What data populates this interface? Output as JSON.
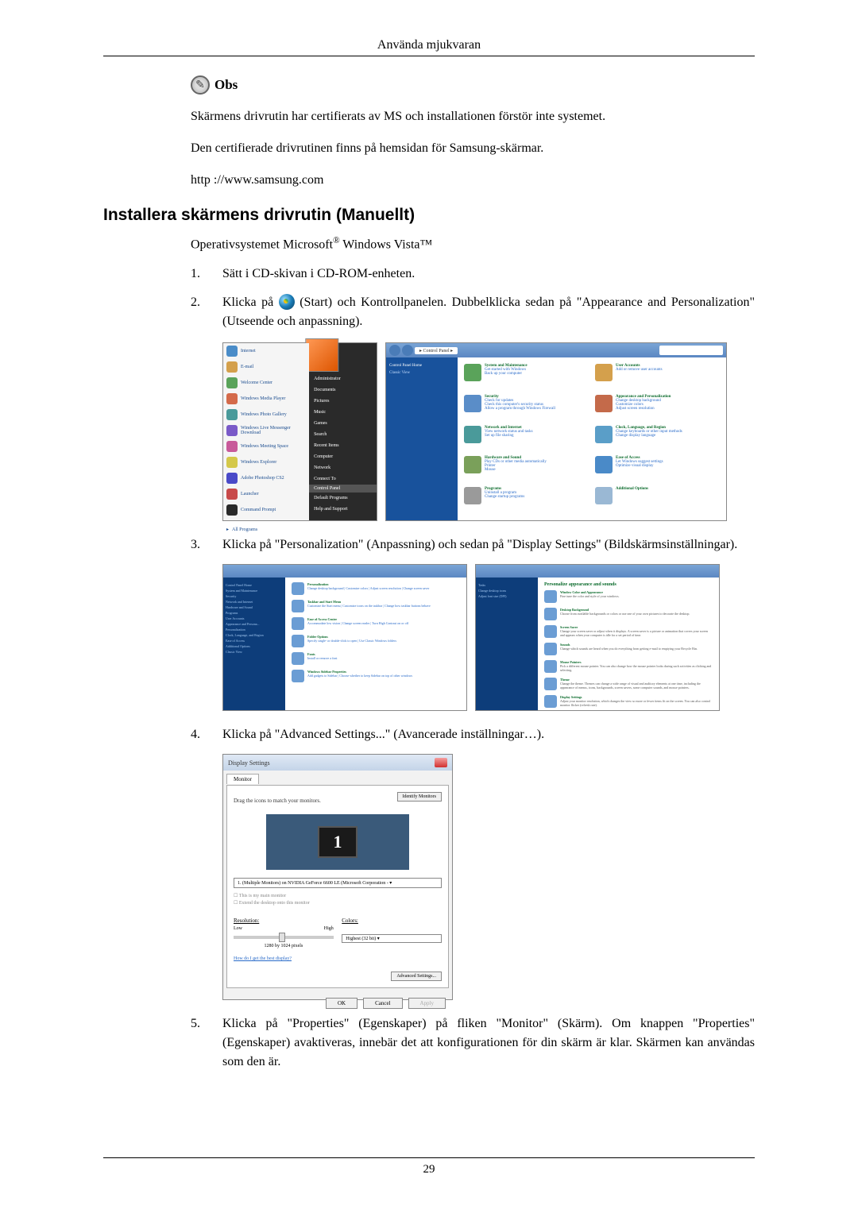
{
  "header": "Använda mjukvaran",
  "obs": {
    "label": "Obs",
    "lines": [
      "Skärmens drivrutin har certifierats av MS och installationen förstör inte systemet.",
      "Den certifierade drivrutinen finns på hemsidan för Samsung-skärmar.",
      "http ://www.samsung.com"
    ]
  },
  "section": {
    "heading": "Installera skärmens drivrutin (Manuellt)",
    "os_line_prefix": "Operativsystemet Microsoft",
    "os_line_suffix": " Windows Vista™"
  },
  "steps": {
    "s1": {
      "num": "1.",
      "text": "Sätt i CD-skivan i CD-ROM-enheten."
    },
    "s2": {
      "num": "2.",
      "text_a": "Klicka på ",
      "text_b": " (Start) och Kontrollpanelen. Dubbelklicka sedan på \"Appearance and Personalization\" (Utseende och anpassning)."
    },
    "s3": {
      "num": "3.",
      "text": "Klicka på \"Personalization\" (Anpassning) och sedan på \"Display Settings\" (Bildskärmsinställningar)."
    },
    "s4": {
      "num": "4.",
      "text": "Klicka på \"Advanced Settings...\" (Avancerade inställningar…)."
    },
    "s5": {
      "num": "5.",
      "text": "Klicka på \"Properties\" (Egenskaper) på fliken \"Monitor\" (Skärm). Om knappen \"Properties\" (Egenskaper) avaktiveras, innebär det att konfigurationen för din skärm är klar. Skärmen kan användas som den är."
    }
  },
  "startmenu": {
    "left": [
      "Internet",
      "E-mail",
      "Welcome Center",
      "Windows Media Player",
      "Windows Photo Gallery",
      "Windows Live Messenger Download",
      "Windows Meeting Space",
      "Windows Explorer",
      "Adobe Photoshop CS2",
      "Launcher",
      "Command Prompt",
      "All Programs"
    ],
    "right": [
      "Administrator",
      "Documents",
      "Pictures",
      "Music",
      "Games",
      "Search",
      "Recent Items",
      "Computer",
      "Network",
      "Connect To",
      "Control Panel",
      "Default Programs",
      "Help and Support"
    ]
  },
  "cp": {
    "breadcrumb": "▸ Control Panel ▸",
    "left": [
      "Control Panel Home",
      "Classic View"
    ],
    "cats": [
      {
        "title": "System and Maintenance",
        "links": [
          "Get started with Windows",
          "Back up your computer"
        ],
        "color": "#5aa35a"
      },
      {
        "title": "User Accounts",
        "links": [
          "Add or remove user accounts"
        ],
        "color": "#d4a04c"
      },
      {
        "title": "Security",
        "links": [
          "Check for updates",
          "Check this computer's security status",
          "Allow a program through Windows Firewall"
        ],
        "color": "#5a8dc8"
      },
      {
        "title": "Appearance and Personalization",
        "links": [
          "Change desktop background",
          "Customize colors",
          "Adjust screen resolution"
        ],
        "color": "#c46a4a"
      },
      {
        "title": "Network and Internet",
        "links": [
          "View network status and tasks",
          "Set up file sharing"
        ],
        "color": "#4a9a9a"
      },
      {
        "title": "Clock, Language, and Region",
        "links": [
          "Change keyboards or other input methods",
          "Change display language"
        ],
        "color": "#5a9ec8"
      },
      {
        "title": "Hardware and Sound",
        "links": [
          "Play CDs or other media automatically",
          "Printer",
          "Mouse"
        ],
        "color": "#7aa05a"
      },
      {
        "title": "Ease of Access",
        "links": [
          "Let Windows suggest settings",
          "Optimize visual display"
        ],
        "color": "#4a8ac8"
      },
      {
        "title": "Programs",
        "links": [
          "Uninstall a program",
          "Change startup programs"
        ],
        "color": "#9a9a9a"
      },
      {
        "title": "Additional Options",
        "links": [],
        "color": "#9ab8d4"
      }
    ]
  },
  "person": {
    "left1": [
      "Control Panel Home",
      "System and Maintenance",
      "Security",
      "Network and Internet",
      "Hardware and Sound",
      "Programs",
      "User Accounts",
      "Appearance and Persona...",
      "Personalization",
      "Clock, Language, and Region",
      "Ease of Access",
      "Additional Options",
      "Classic View"
    ],
    "sections1": [
      {
        "title": "Personalization",
        "sub": "Change desktop background | Customize colors | Adjust screen resolution | Change screen saver"
      },
      {
        "title": "Taskbar and Start Menu",
        "sub": "Customize the Start menu | Customize icons on the taskbar | Change how taskbar buttons behave"
      },
      {
        "title": "Ease of Access Center",
        "sub": "Accommodate low vision | Change screen reader | Turn High Contrast on or off"
      },
      {
        "title": "Folder Options",
        "sub": "Specify single- or double-click to open | Use Classic Windows folders"
      },
      {
        "title": "Fonts",
        "sub": "Install or remove a font"
      },
      {
        "title": "Windows Sidebar Properties",
        "sub": "Add gadgets to Sidebar | Choose whether to keep Sidebar on top of other windows"
      }
    ],
    "left2": [
      "Tasks",
      "Change desktop icons",
      "Adjust font size (DPI)"
    ],
    "heading2": "Personalize appearance and sounds",
    "sections2": [
      {
        "title": "Window Color and Appearance",
        "sub": "Fine tune the color and style of your windows."
      },
      {
        "title": "Desktop Background",
        "sub": "Choose from available backgrounds or colors or use one of your own pictures to decorate the desktop."
      },
      {
        "title": "Screen Saver",
        "sub": "Change your screen saver or adjust when it displays. A screen saver is a picture or animation that covers your screen and appears when your computer is idle for a set period of time."
      },
      {
        "title": "Sounds",
        "sub": "Change which sounds are heard when you do everything from getting e-mail to emptying your Recycle Bin."
      },
      {
        "title": "Mouse Pointers",
        "sub": "Pick a different mouse pointer. You can also change how the mouse pointer looks during such activities as clicking and selecting."
      },
      {
        "title": "Theme",
        "sub": "Change the theme. Themes can change a wide range of visual and auditory elements at one time, including the appearance of menus, icons, backgrounds, screen savers, some computer sounds, and mouse pointers."
      },
      {
        "title": "Display Settings",
        "sub": "Adjust your monitor resolution, which changes the view so more or fewer items fit on the screen. You can also control monitor flicker (refresh rate)."
      }
    ]
  },
  "display": {
    "title": "Display Settings",
    "tab": "Monitor",
    "drag_text": "Drag the icons to match your monitors.",
    "identify": "Identify Monitors",
    "monitor_num": "1",
    "dropdown": "1. (Multiple Monitors) on NVIDIA GeForce 6600 LE (Microsoft Corporation - ▾",
    "chk1": "This is my main monitor",
    "chk2": "Extend the desktop onto this monitor",
    "res_label": "Resolution:",
    "low": "Low",
    "high": "High",
    "res_value": "1280 by 1024 pixels",
    "color_label": "Colors:",
    "color_value": "Highest (32 bit)",
    "help_link": "How do I get the best display?",
    "advanced": "Advanced Settings...",
    "ok": "OK",
    "cancel": "Cancel",
    "apply": "Apply"
  },
  "page_number": "29"
}
